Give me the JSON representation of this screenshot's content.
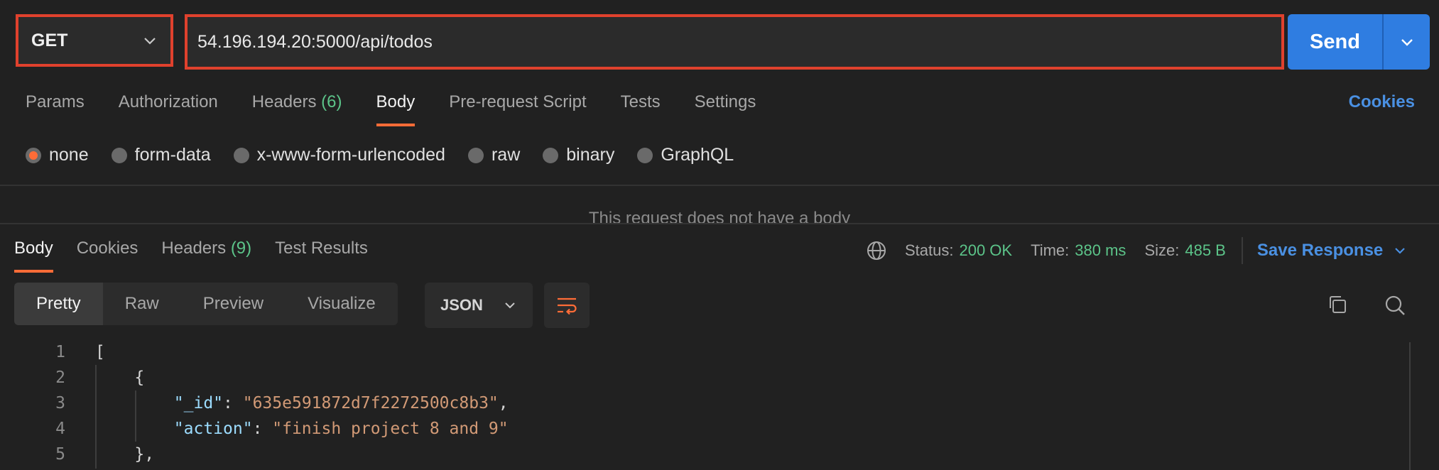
{
  "request": {
    "method": "GET",
    "url": "54.196.194.20:5000/api/todos",
    "send_label": "Send"
  },
  "request_tabs": [
    {
      "label": "Params"
    },
    {
      "label": "Authorization"
    },
    {
      "label": "Headers",
      "count": "(6)"
    },
    {
      "label": "Body",
      "active": true
    },
    {
      "label": "Pre-request Script"
    },
    {
      "label": "Tests"
    },
    {
      "label": "Settings"
    }
  ],
  "cookies_label": "Cookies",
  "body_types": [
    {
      "label": "none",
      "checked": true
    },
    {
      "label": "form-data"
    },
    {
      "label": "x-www-form-urlencoded"
    },
    {
      "label": "raw"
    },
    {
      "label": "binary"
    },
    {
      "label": "GraphQL"
    }
  ],
  "no_body_message": "This request does not have a body",
  "response_tabs": [
    {
      "label": "Body",
      "active": true
    },
    {
      "label": "Cookies"
    },
    {
      "label": "Headers",
      "count": "(9)"
    },
    {
      "label": "Test Results"
    }
  ],
  "response_meta": {
    "status_label": "Status:",
    "status_value": "200 OK",
    "time_label": "Time:",
    "time_value": "380 ms",
    "size_label": "Size:",
    "size_value": "485 B",
    "save_label": "Save Response"
  },
  "view_tabs": [
    {
      "label": "Pretty",
      "active": true
    },
    {
      "label": "Raw"
    },
    {
      "label": "Preview"
    },
    {
      "label": "Visualize"
    }
  ],
  "format": "JSON",
  "code_lines": [
    {
      "n": "1",
      "text": "["
    },
    {
      "n": "2",
      "text": "    {"
    },
    {
      "n": "3",
      "key": "\"_id\"",
      "sep": ": ",
      "val": "\"635e591872d7f2272500c8b3\"",
      "end": ","
    },
    {
      "n": "4",
      "key": "\"action\"",
      "sep": ": ",
      "val": "\"finish project 8 and 9\"",
      "end": ""
    },
    {
      "n": "5",
      "text": "    },"
    }
  ],
  "colors": {
    "accent": "#ff6c37",
    "primary": "#2f7de1",
    "highlight_border": "#e0412d",
    "success": "#5cc489",
    "link": "#4a90e2"
  }
}
